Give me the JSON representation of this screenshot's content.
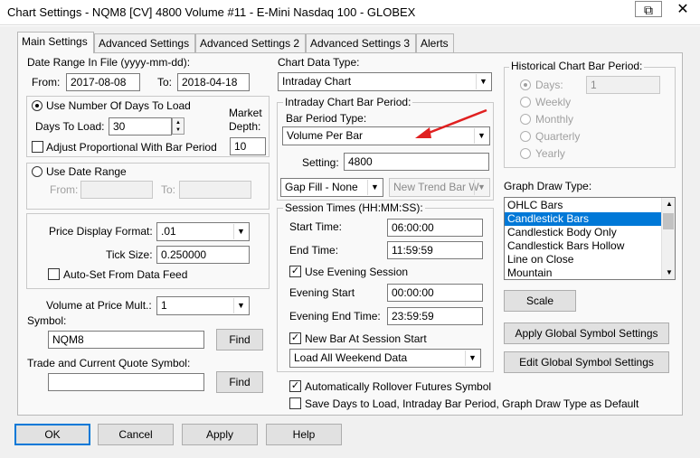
{
  "window": {
    "title": "Chart Settings - NQM8 [CV]  4800 Volume  #11 - E-Mini Nasdaq 100 - GLOBEX",
    "restore_glyph": "⧉",
    "close_glyph": "✕"
  },
  "tabs": [
    {
      "label": "Main Settings",
      "active": true
    },
    {
      "label": "Advanced Settings"
    },
    {
      "label": "Advanced Settings 2"
    },
    {
      "label": "Advanced Settings 3"
    },
    {
      "label": "Alerts"
    }
  ],
  "date_range": {
    "label": "Date Range In File (yyyy-mm-dd):",
    "from_label": "From:",
    "from_value": "2017-08-08",
    "to_label": "To:",
    "to_value": "2018-04-18"
  },
  "days_group": {
    "radio_label": "Use Number Of Days To Load",
    "days_label": "Days To Load:",
    "days_value": "30",
    "market_depth_label_1": "Market",
    "market_depth_label_2": "Depth:",
    "market_depth_value": "10",
    "adjust_label": "Adjust Proportional With Bar Period"
  },
  "date_range_group": {
    "radio_label": "Use Date Range",
    "from_label": "From:",
    "to_label": "To:"
  },
  "price_group": {
    "format_label": "Price Display Format:",
    "format_value": ".01",
    "tick_label": "Tick Size:",
    "tick_value": "0.250000",
    "autoset_label": "Auto-Set From Data Feed"
  },
  "volume": {
    "label": "Volume at Price Mult.:",
    "value": "1"
  },
  "symbol": {
    "label": "Symbol:",
    "value": "NQM8",
    "find": "Find"
  },
  "trade_symbol": {
    "label": "Trade and Current Quote Symbol:",
    "value": "",
    "find": "Find"
  },
  "chart_data": {
    "label": "Chart Data Type:",
    "value": "Intraday Chart"
  },
  "intraday": {
    "group_label": "Intraday Chart Bar Period:",
    "bar_type_label": "Bar Period Type:",
    "bar_type_value": "Volume Per Bar",
    "setting_label": "Setting:",
    "setting_value": "4800",
    "gap_fill_value": "Gap Fill - None",
    "new_trend_value": "New Trend Bar W"
  },
  "session": {
    "group_label": "Session Times (HH:MM:SS):",
    "start_label": "Start Time:",
    "start_value": "06:00:00",
    "end_label": "End Time:",
    "end_value": "11:59:59",
    "evening_check_label": "Use Evening Session",
    "evening_start_label": "Evening Start",
    "evening_start_value": "00:00:00",
    "evening_end_label": "Evening End Time:",
    "evening_end_value": "23:59:59",
    "new_bar_label": "New Bar At Session Start",
    "weekend_value": "Load All Weekend Data"
  },
  "rollover_label": "Automatically Rollover Futures Symbol",
  "save_default_label": "Save Days to Load, Intraday Bar Period, Graph Draw Type as Default",
  "historical": {
    "group_label": "Historical Chart Bar Period:",
    "days_label": "Days:",
    "days_value": "1",
    "options": [
      "Weekly",
      "Monthly",
      "Quarterly",
      "Yearly"
    ]
  },
  "graph_draw": {
    "label": "Graph Draw Type:",
    "items": [
      "OHLC Bars",
      "Candlestick Bars",
      "Candlestick Body Only",
      "Candlestick Bars Hollow",
      "Line on Close",
      "Mountain"
    ],
    "selected": "Candlestick Bars"
  },
  "buttons": {
    "scale": "Scale",
    "apply_global": "Apply Global Symbol Settings",
    "edit_global": "Edit Global Symbol Settings",
    "ok": "OK",
    "cancel": "Cancel",
    "apply": "Apply",
    "help": "Help"
  },
  "colors": {
    "accent": "#0078d7",
    "annotation_arrow": "#e02020"
  }
}
